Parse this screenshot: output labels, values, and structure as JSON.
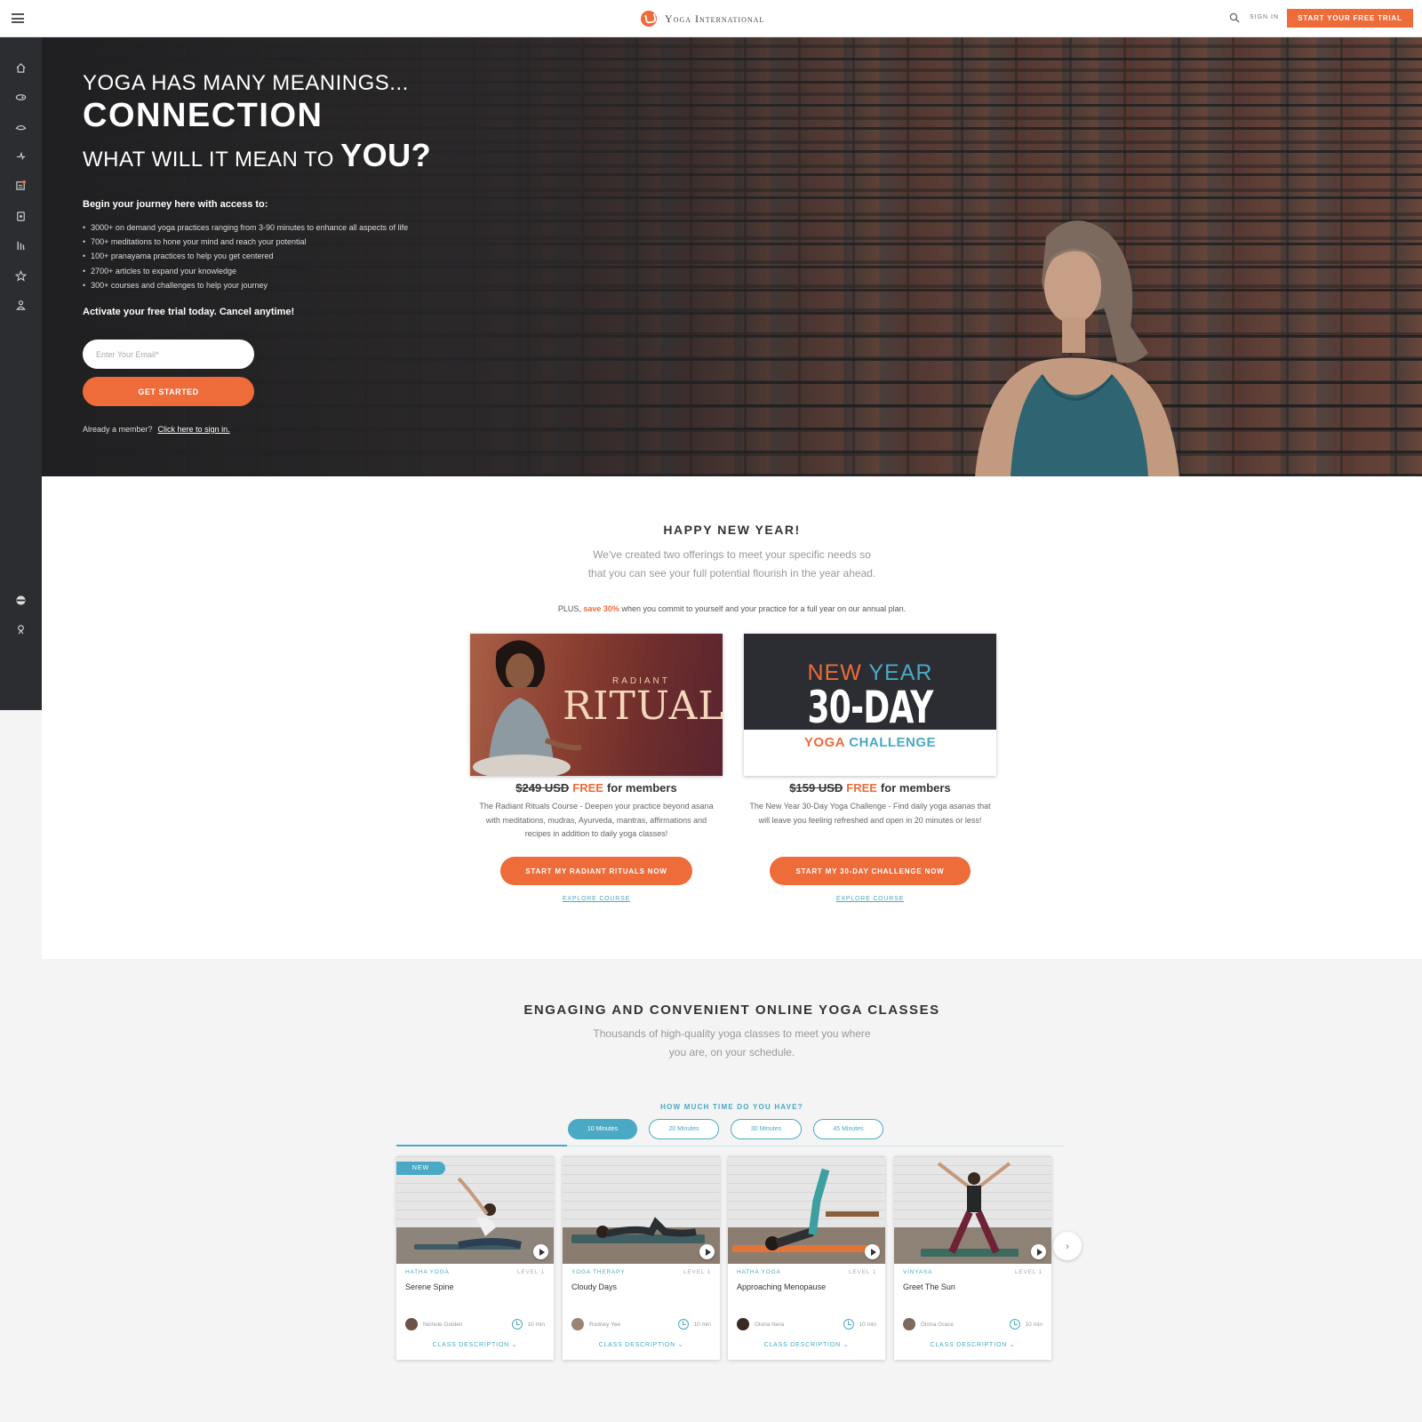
{
  "header": {
    "logo_text": "Yoga International",
    "signin_label": "SIGN IN",
    "cta_label": "START YOUR FREE TRIAL"
  },
  "hero": {
    "line1": "YOGA HAS MANY MEANINGS...",
    "line2": "CONNECTION",
    "line3_prefix": "WHAT WILL IT MEAN TO",
    "line3_emphasis": "YOU?",
    "intro": "Begin your journey here with access to:",
    "bullets": [
      "3000+ on demand yoga practices ranging from 3-90 minutes to enhance all aspects of life",
      "700+ meditations to hone your mind and reach your potential",
      "100+ pranayama practices to help you get centered",
      "2700+ articles to expand your knowledge",
      "300+ courses and challenges to help your journey"
    ],
    "trial_text": "Activate your free trial today. Cancel anytime!",
    "email_placeholder": "Enter Your Email*",
    "get_started_label": "GET STARTED",
    "member_text": "Already a member?",
    "member_link": "Click here to sign in."
  },
  "new_year": {
    "title": "HAPPY NEW YEAR!",
    "subtitle_line1": "We've created two offerings to meet your specific needs so",
    "subtitle_line2": "that you can see your full potential flourish in the year ahead.",
    "plus_prefix": "PLUS,",
    "plus_highlight": "save 30%",
    "plus_suffix": "when you commit to yourself and your practice for a full year on our annual plan.",
    "cards": [
      {
        "art_small": "RADIANT",
        "art_big": "RITUALS",
        "old_price": "$249 USD",
        "free_label": "FREE",
        "members_label": "for members",
        "description": "The Radiant Rituals Course - Deepen your practice beyond asana with meditations, mudras, Ayurveda, mantras, affirmations and recipes in addition to daily yoga classes!",
        "button_label": "START MY RADIANT RITUALS NOW",
        "link_label": "EXPLORE COURSE"
      },
      {
        "art_top_a": "NEW",
        "art_top_b": "YEAR",
        "art_big": "30-DAY",
        "art_sub_a": "YOGA",
        "art_sub_b": "CHALLENGE",
        "old_price": "$159 USD",
        "free_label": "FREE",
        "members_label": "for members",
        "description": "The New Year 30-Day Yoga Challenge - Find daily yoga asanas that will leave you feeling refreshed and open in 20 minutes or less!",
        "button_label": "START MY 30-DAY CHALLENGE NOW",
        "link_label": "EXPLORE COURSE"
      }
    ]
  },
  "classes": {
    "title": "ENGAGING AND CONVENIENT ONLINE YOGA CLASSES",
    "subtitle_line1": "Thousands of high-quality yoga classes to meet you where",
    "subtitle_line2": "you are, on your schedule.",
    "time_question": "HOW MUCH TIME DO YOU HAVE?",
    "time_options": [
      "10 Minutes",
      "20 Minutes",
      "30 Minutes",
      "45 Minutes"
    ],
    "active_time_index": 0,
    "new_badge": "NEW",
    "description_label": "CLASS DESCRIPTION",
    "items": [
      {
        "style": "HATHA YOGA",
        "level": "LEVEL 1",
        "title": "Serene Spine",
        "teacher": "Nichole Golden",
        "duration": "10 min"
      },
      {
        "style": "YOGA THERAPY",
        "level": "LEVEL 1",
        "title": "Cloudy Days",
        "teacher": "Rodney Yee",
        "duration": "10 min"
      },
      {
        "style": "HATHA YOGA",
        "level": "LEVEL 1",
        "title": "Approaching Menopause",
        "teacher": "Gloria Nera",
        "duration": "10 min"
      },
      {
        "style": "VINYASA",
        "level": "LEVEL 1",
        "title": "Greet The Sun",
        "teacher": "Gloria Grace",
        "duration": "10 min"
      }
    ]
  },
  "colors": {
    "accent_orange": "#ee6b3a",
    "accent_teal": "#4aa9c4",
    "sidebar_bg": "#2b2d31"
  }
}
